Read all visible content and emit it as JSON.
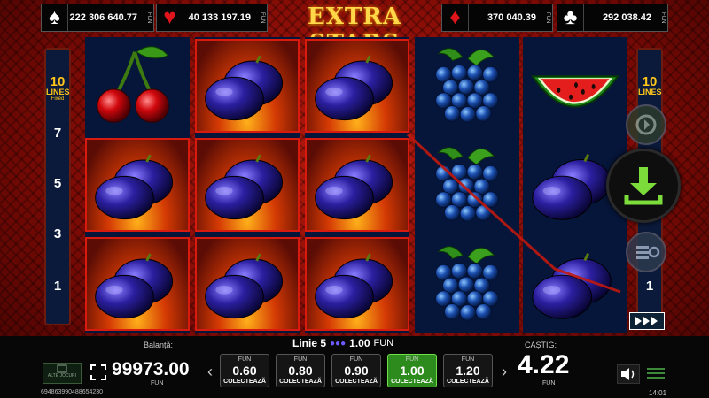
{
  "jackpots": [
    {
      "suit": "spade",
      "symbol": "♠",
      "value": "222 306 640.77",
      "unit": "FUN",
      "color": "#ffffff"
    },
    {
      "suit": "heart",
      "symbol": "♥",
      "value": "40 133 197.19",
      "unit": "FUN",
      "color": "#e0151b"
    },
    {
      "suit": "diamond",
      "symbol": "♦",
      "value": "370 040.39",
      "unit": "FUN",
      "color": "#e0151b"
    },
    {
      "suit": "club",
      "symbol": "♣",
      "value": "292 038.42",
      "unit": "FUN",
      "color": "#ffffff"
    }
  ],
  "game_title": "EXTRA STARS",
  "lines_panel": {
    "count": "10",
    "word": "LINES",
    "fixed": "Fixed",
    "left_numbers": [
      "7",
      "5",
      "3",
      "1"
    ],
    "right_numbers": [
      "1"
    ]
  },
  "reels": [
    [
      "cherry",
      "plum",
      "plum"
    ],
    [
      "plum",
      "plum",
      "plum"
    ],
    [
      "plum",
      "plum",
      "plum"
    ],
    [
      "grapes",
      "grapes",
      "grapes"
    ],
    [
      "watermelon",
      "plum",
      "plum"
    ]
  ],
  "win_line": {
    "line": "Linie 5",
    "amount": "1.00",
    "unit": "FUN"
  },
  "balance": {
    "label": "Balanță:",
    "value": "99973.00",
    "unit": "FUN"
  },
  "bets": [
    {
      "top": "FUN",
      "value": "0.60",
      "action": "COLECTEAZĂ",
      "active": false
    },
    {
      "top": "FUN",
      "value": "0.80",
      "action": "COLECTEAZĂ",
      "active": false
    },
    {
      "top": "FUN",
      "value": "0.90",
      "action": "COLECTEAZĂ",
      "active": false
    },
    {
      "top": "FUN",
      "value": "1.00",
      "action": "COLECTEAZĂ",
      "active": true
    },
    {
      "top": "FUN",
      "value": "1.20",
      "action": "COLECTEAZĂ",
      "active": false
    }
  ],
  "win": {
    "label": "CÂȘTIG:",
    "value": "4.22",
    "unit": "FUN"
  },
  "other_games": "ALTE JOCURI",
  "session_id": "694863990488654230",
  "clock": "14:01",
  "colors": {
    "accent_green": "#6fe04a",
    "gold": "#ffc61a",
    "reel_bg": "#06163a",
    "win_line": "#c0180f"
  }
}
